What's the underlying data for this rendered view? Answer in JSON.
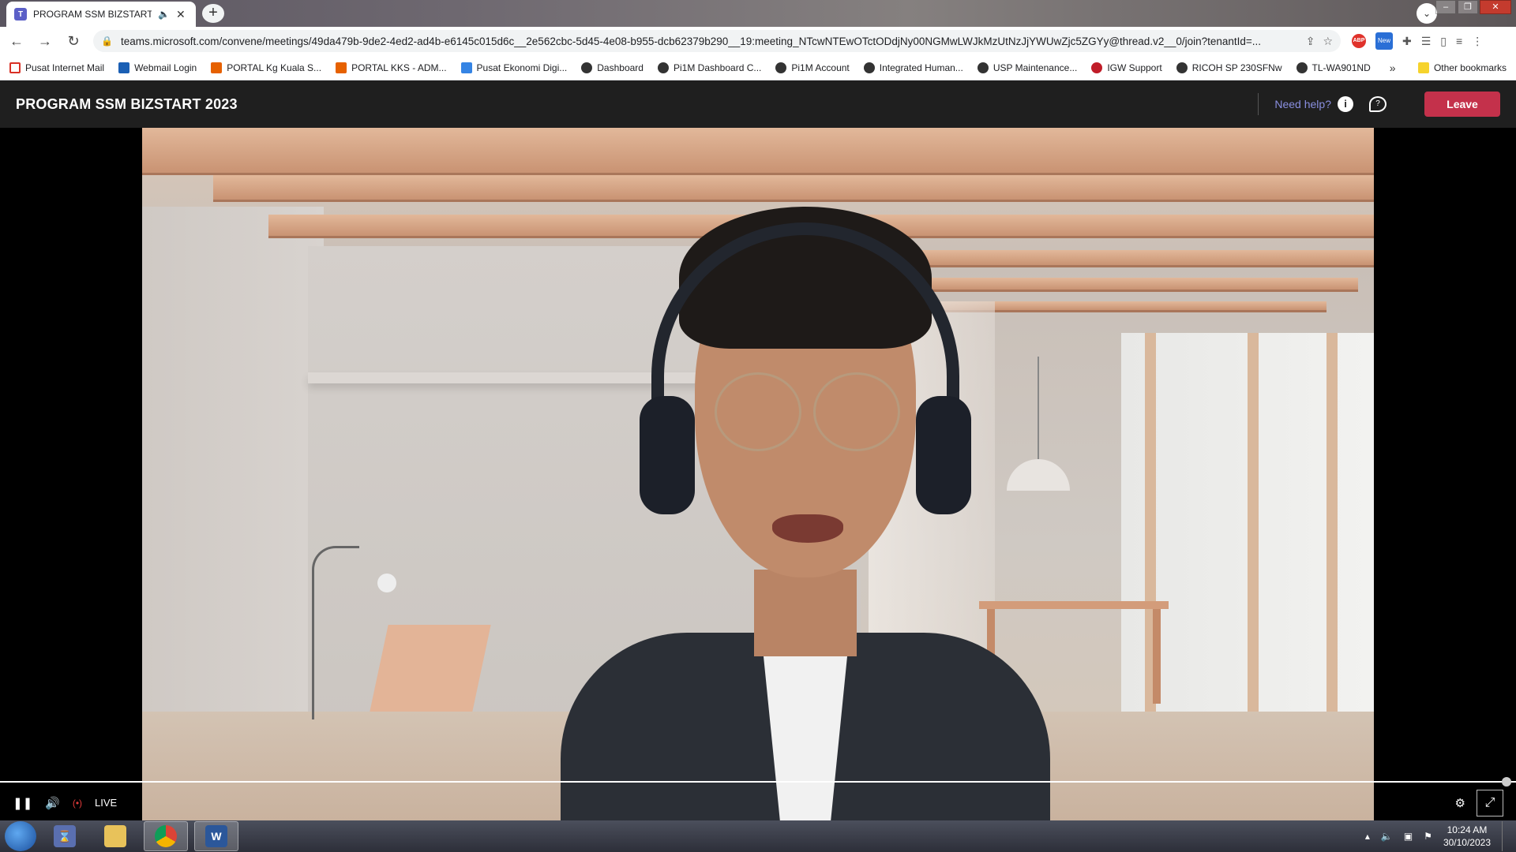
{
  "browser": {
    "tab_title": "PROGRAM SSM BIZSTART 2023",
    "url": "teams.microsoft.com/convene/meetings/49da479b-9de2-4ed2-ad4b-e6145c015d6c__2e562cbc-5d45-4e08-b955-dcb62379b290__19:meeting_NTcwNTEwOTctODdjNy00NGMwLWJkMzUtNzJjYWUwZjc5ZGYy@thread.v2__0/join?tenantId=...",
    "new_tab_label": "+"
  },
  "bookmarks": [
    {
      "label": "Pusat Internet  Mail",
      "icon": "gmail-icon"
    },
    {
      "label": "Webmail Login",
      "icon": "mail-icon"
    },
    {
      "label": "PORTAL Kg Kuala S...",
      "icon": "portal-icon"
    },
    {
      "label": "PORTAL KKS - ADM...",
      "icon": "portal-icon"
    },
    {
      "label": "Pusat Ekonomi Digi...",
      "icon": "triangle-icon"
    },
    {
      "label": "Dashboard",
      "icon": "globe-icon"
    },
    {
      "label": "Pi1M Dashboard C...",
      "icon": "globe-icon"
    },
    {
      "label": "Pi1M Account",
      "icon": "globe-icon"
    },
    {
      "label": "Integrated Human...",
      "icon": "globe-icon"
    },
    {
      "label": "USP Maintenance...",
      "icon": "globe-icon"
    },
    {
      "label": "IGW Support",
      "icon": "support-icon"
    },
    {
      "label": "RICOH SP 230SFNw",
      "icon": "globe-icon"
    },
    {
      "label": "TL-WA901ND",
      "icon": "globe-icon"
    }
  ],
  "bookmarks_more": "»",
  "other_bookmarks": "Other bookmarks",
  "meeting": {
    "title": "PROGRAM SSM BIZSTART 2023",
    "help_label": "Need help?",
    "leave_label": "Leave"
  },
  "player": {
    "live_label": "LIVE",
    "progress": 1.0
  },
  "taskbar": {
    "time": "10:24 AM",
    "date": "30/10/2023",
    "word_label": "W"
  },
  "colors": {
    "leave": "#c4314b",
    "help_link": "#8a8fe0",
    "header_bg": "#1f1f1f"
  }
}
